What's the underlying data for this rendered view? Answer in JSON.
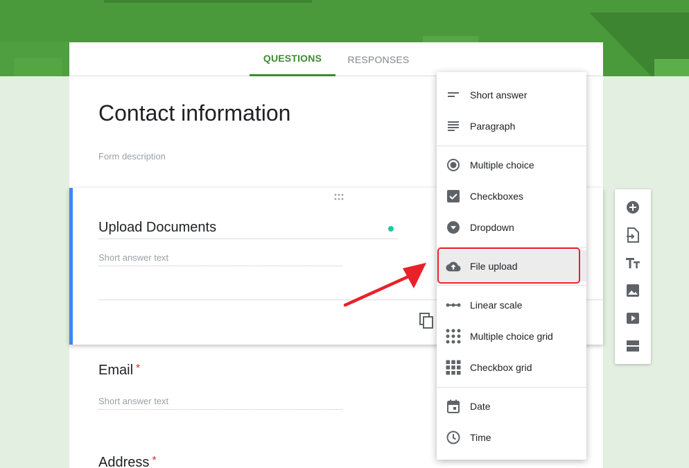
{
  "tabs": {
    "questions": "QUESTIONS",
    "responses": "RESPONSES"
  },
  "form": {
    "title": "Contact information",
    "description_placeholder": "Form description"
  },
  "questions": [
    {
      "title": "Upload Documents",
      "answer_placeholder": "Short answer text",
      "required": false
    },
    {
      "title": "Email",
      "answer_placeholder": "Short answer text",
      "required": true
    },
    {
      "title": "Address",
      "required": true
    }
  ],
  "required_marker": "*",
  "menu": {
    "items": [
      {
        "label": "Short answer",
        "icon": "short-answer-icon"
      },
      {
        "label": "Paragraph",
        "icon": "paragraph-icon"
      },
      {
        "label": "Multiple choice",
        "icon": "radio-icon"
      },
      {
        "label": "Checkboxes",
        "icon": "checkbox-icon"
      },
      {
        "label": "Dropdown",
        "icon": "dropdown-icon"
      },
      {
        "label": "File upload",
        "icon": "cloud-upload-icon",
        "highlighted": true
      },
      {
        "label": "Linear scale",
        "icon": "linear-scale-icon"
      },
      {
        "label": "Multiple choice grid",
        "icon": "dot-grid-icon"
      },
      {
        "label": "Checkbox grid",
        "icon": "checkbox-grid-icon"
      },
      {
        "label": "Date",
        "icon": "calendar-icon"
      },
      {
        "label": "Time",
        "icon": "clock-icon"
      }
    ]
  },
  "toolbar": {
    "buttons": [
      "add-question-icon",
      "import-questions-icon",
      "add-title-icon",
      "add-image-icon",
      "add-video-icon",
      "add-section-icon"
    ]
  },
  "colors": {
    "accent": "#3b8c2c",
    "banner": "#4a9a3b",
    "background": "#e3efe0",
    "active_border": "#4285f4",
    "annotation": "#e8212a"
  }
}
